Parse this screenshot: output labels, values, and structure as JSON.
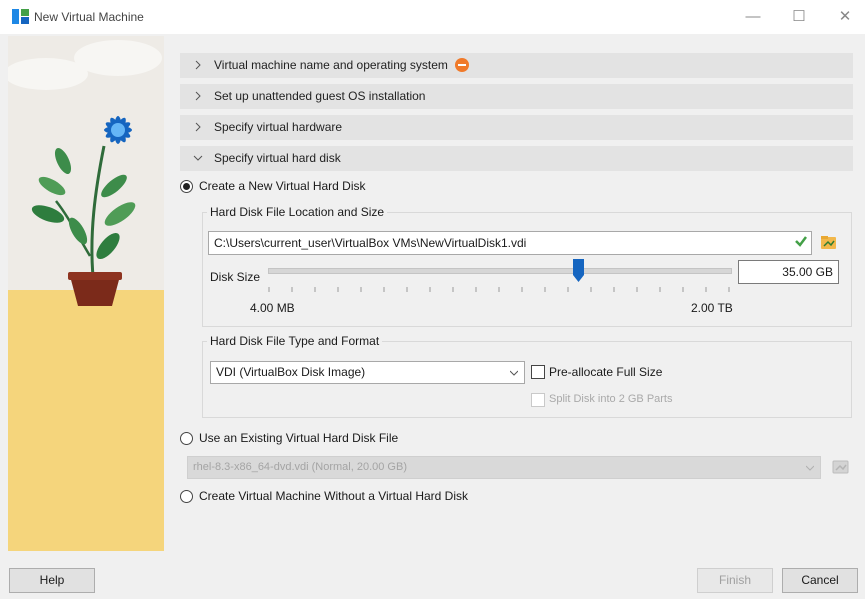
{
  "window": {
    "title": "New Virtual Machine",
    "controls": {
      "minimize": "—",
      "maximize": "☐",
      "close": "✕"
    }
  },
  "sections": [
    {
      "label": "Virtual machine name and operating system",
      "expanded": false,
      "warning": true
    },
    {
      "label": "Set up unattended guest OS installation",
      "expanded": false
    },
    {
      "label": "Specify virtual hardware",
      "expanded": false
    },
    {
      "label": "Specify virtual hard disk",
      "expanded": true
    }
  ],
  "disk_options": {
    "create_new": {
      "label": "Create a New Virtual Hard Disk",
      "selected": true
    },
    "use_existing": {
      "label": "Use an Existing Virtual Hard Disk File",
      "selected": false
    },
    "no_disk": {
      "label": "Create Virtual Machine Without a Virtual Hard Disk",
      "selected": false
    }
  },
  "location_group": {
    "title": "Hard Disk File Location and Size",
    "path": "C:\\Users\\current_user\\VirtualBox VMs\\NewVirtualDisk1.vdi",
    "disk_size_label": "Disk Size",
    "disk_size_value": "35.00 GB",
    "slider_min_label": "4.00 MB",
    "slider_max_label": "2.00 TB",
    "slider_fraction": 0.67
  },
  "type_group": {
    "title": "Hard Disk File Type and Format",
    "format_selected": "VDI (VirtualBox Disk Image)",
    "preallocate_label": "Pre-allocate Full Size",
    "split_label": "Split Disk into 2 GB Parts"
  },
  "existing_file": {
    "value": "rhel-8.3-x86_64-dvd.vdi (Normal, 20.00 GB)"
  },
  "footer": {
    "help": "Help",
    "finish": "Finish",
    "cancel": "Cancel"
  },
  "colors": {
    "accent": "#1565c0",
    "section_bg": "#e3e3e3",
    "warning": "#f07a2a",
    "art_ground": "#f5d57c"
  }
}
